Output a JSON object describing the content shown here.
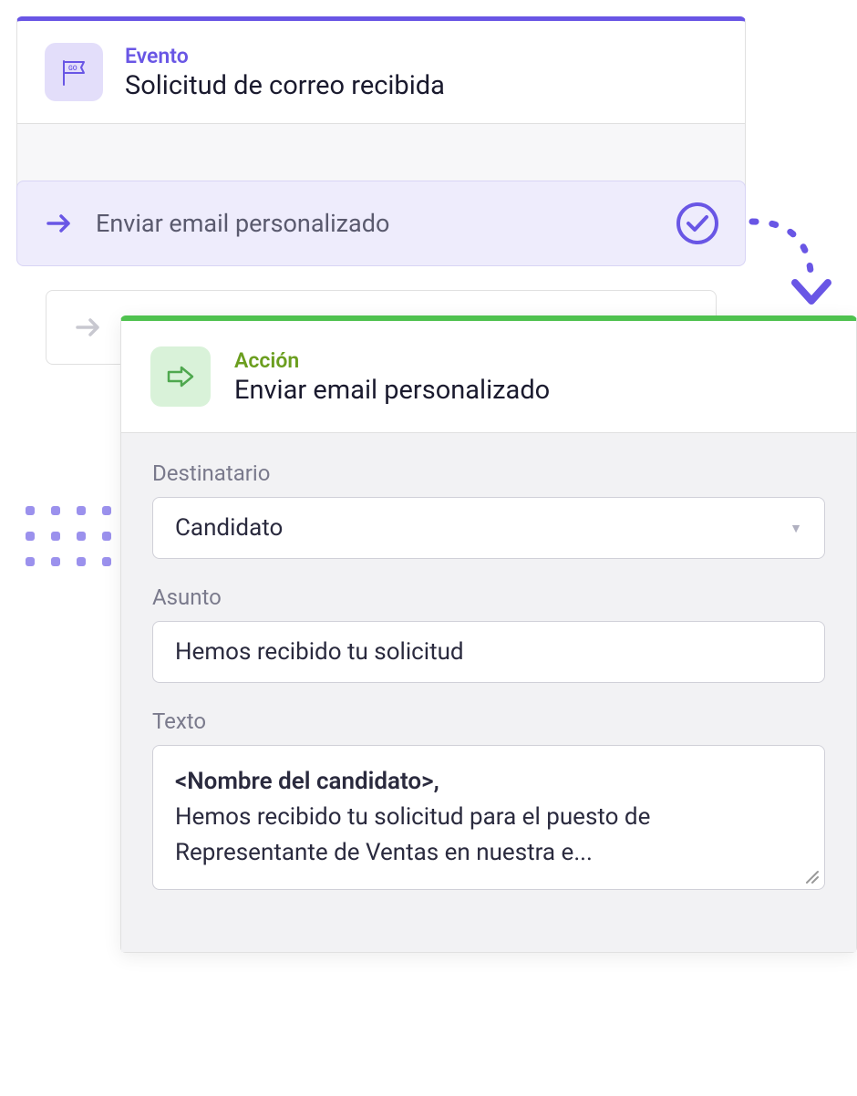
{
  "event": {
    "label": "Evento",
    "title": "Solicitud de correo recibida"
  },
  "steps": {
    "active": {
      "text": "Enviar email personalizado"
    }
  },
  "action": {
    "label": "Acción",
    "title": "Enviar email personalizado",
    "form": {
      "recipient": {
        "label": "Destinatario",
        "value": "Candidato"
      },
      "subject": {
        "label": "Asunto",
        "value": "Hemos recibido tu solicitud"
      },
      "body": {
        "label": "Texto",
        "placeholder_name": "<Nombre del candidato>,",
        "content": "Hemos recibido tu solicitud para el puesto de Representante de Ventas en nuestra e..."
      }
    }
  }
}
